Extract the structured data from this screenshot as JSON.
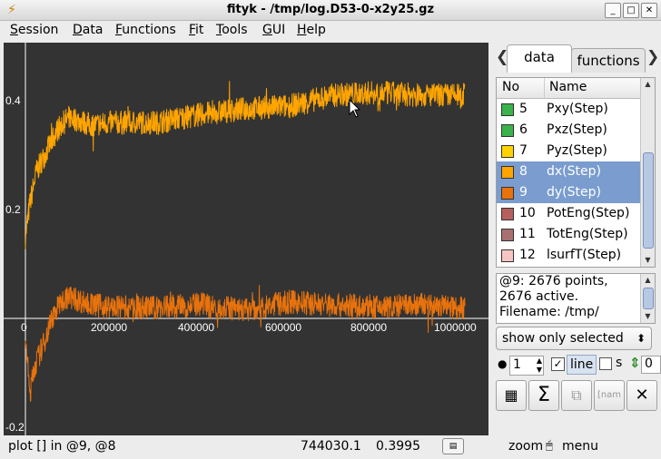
{
  "window": {
    "title": "fityk - /tmp/log.D53-0-x2y25.gz",
    "app_icon": "fityk-logo-icon"
  },
  "menubar": {
    "items": [
      {
        "label": "Session",
        "u": "S",
        "rest": "ession"
      },
      {
        "label": "Data",
        "u": "D",
        "rest": "ata"
      },
      {
        "label": "Functions",
        "u": "F",
        "rest": "unctions"
      },
      {
        "label": "Fit",
        "u": "F",
        "rest": "it"
      },
      {
        "label": "Tools",
        "u": "T",
        "rest": "ools"
      },
      {
        "label": "GUI",
        "u": "G",
        "rest": "UI"
      },
      {
        "label": "Help",
        "u": "H",
        "rest": "elp"
      }
    ]
  },
  "plot": {
    "background": "#333333",
    "x_ticks": [
      "0",
      "200000",
      "400000",
      "600000",
      "800000",
      "1000000"
    ],
    "y_ticks": [
      "0.4",
      "0.2",
      "-0.2"
    ]
  },
  "chart_data": {
    "type": "line",
    "xlim": [
      -40000,
      1060000
    ],
    "ylim": [
      -0.22,
      0.47
    ],
    "series": [
      {
        "color": "#ffa500",
        "x": [
          0,
          10000,
          25000,
          50000,
          75000,
          100000,
          150000,
          200000,
          300000,
          400000,
          500000,
          600000,
          700000,
          800000,
          900000,
          1000000
        ],
        "y": [
          0.15,
          0.21,
          0.27,
          0.31,
          0.35,
          0.37,
          0.355,
          0.36,
          0.36,
          0.375,
          0.385,
          0.39,
          0.41,
          0.415,
          0.41,
          0.41
        ]
      },
      {
        "color": "#e8720c",
        "x": [
          0,
          10000,
          20000,
          40000,
          60000,
          80000,
          100000,
          150000,
          200000,
          300000,
          400000,
          500000,
          600000,
          700000,
          800000,
          900000,
          1000000
        ],
        "y": [
          -0.03,
          -0.14,
          -0.09,
          -0.05,
          0.0,
          0.03,
          0.04,
          0.025,
          0.02,
          0.02,
          0.025,
          0.015,
          0.03,
          0.025,
          0.02,
          0.025,
          0.02
        ]
      }
    ]
  },
  "sidepanel": {
    "tabs": [
      {
        "label": "data"
      },
      {
        "label": "functions"
      }
    ],
    "list_header": {
      "no": "No",
      "name": "Name"
    },
    "rows": [
      {
        "no": "5",
        "name": "Pxy(Step)",
        "color": "#3cb24a",
        "selected": false
      },
      {
        "no": "6",
        "name": "Pxz(Step)",
        "color": "#3cb24a",
        "selected": false
      },
      {
        "no": "7",
        "name": "Pyz(Step)",
        "color": "#ffd200",
        "selected": false
      },
      {
        "no": "8",
        "name": "dx(Step)",
        "color": "#ffa500",
        "selected": true
      },
      {
        "no": "9",
        "name": "dy(Step)",
        "color": "#e8720c",
        "selected": true
      },
      {
        "no": "10",
        "name": "PotEng(Step)",
        "color": "#b65f5f",
        "selected": false
      },
      {
        "no": "11",
        "name": "TotEng(Step)",
        "color": "#a87070",
        "selected": false
      },
      {
        "no": "12",
        "name": "lsurfT(Step)",
        "color": "#f7c4c4",
        "selected": false
      }
    ],
    "info_lines": [
      "@9: 2676 points,",
      "2676 active.",
      "Filename: /tmp/"
    ],
    "filter_select": "show only selected",
    "controls": {
      "point_size": "1",
      "line_label": "line",
      "s_label": "s",
      "spin_value": "0",
      "line_checked": true,
      "s_checked": false
    }
  },
  "statusbar": {
    "text": "plot [] in @9, @8",
    "x_coord": "744030.1",
    "y_coord": "0.3995",
    "mouse_mode_left": "zoom",
    "mouse_mode_right": "menu"
  }
}
